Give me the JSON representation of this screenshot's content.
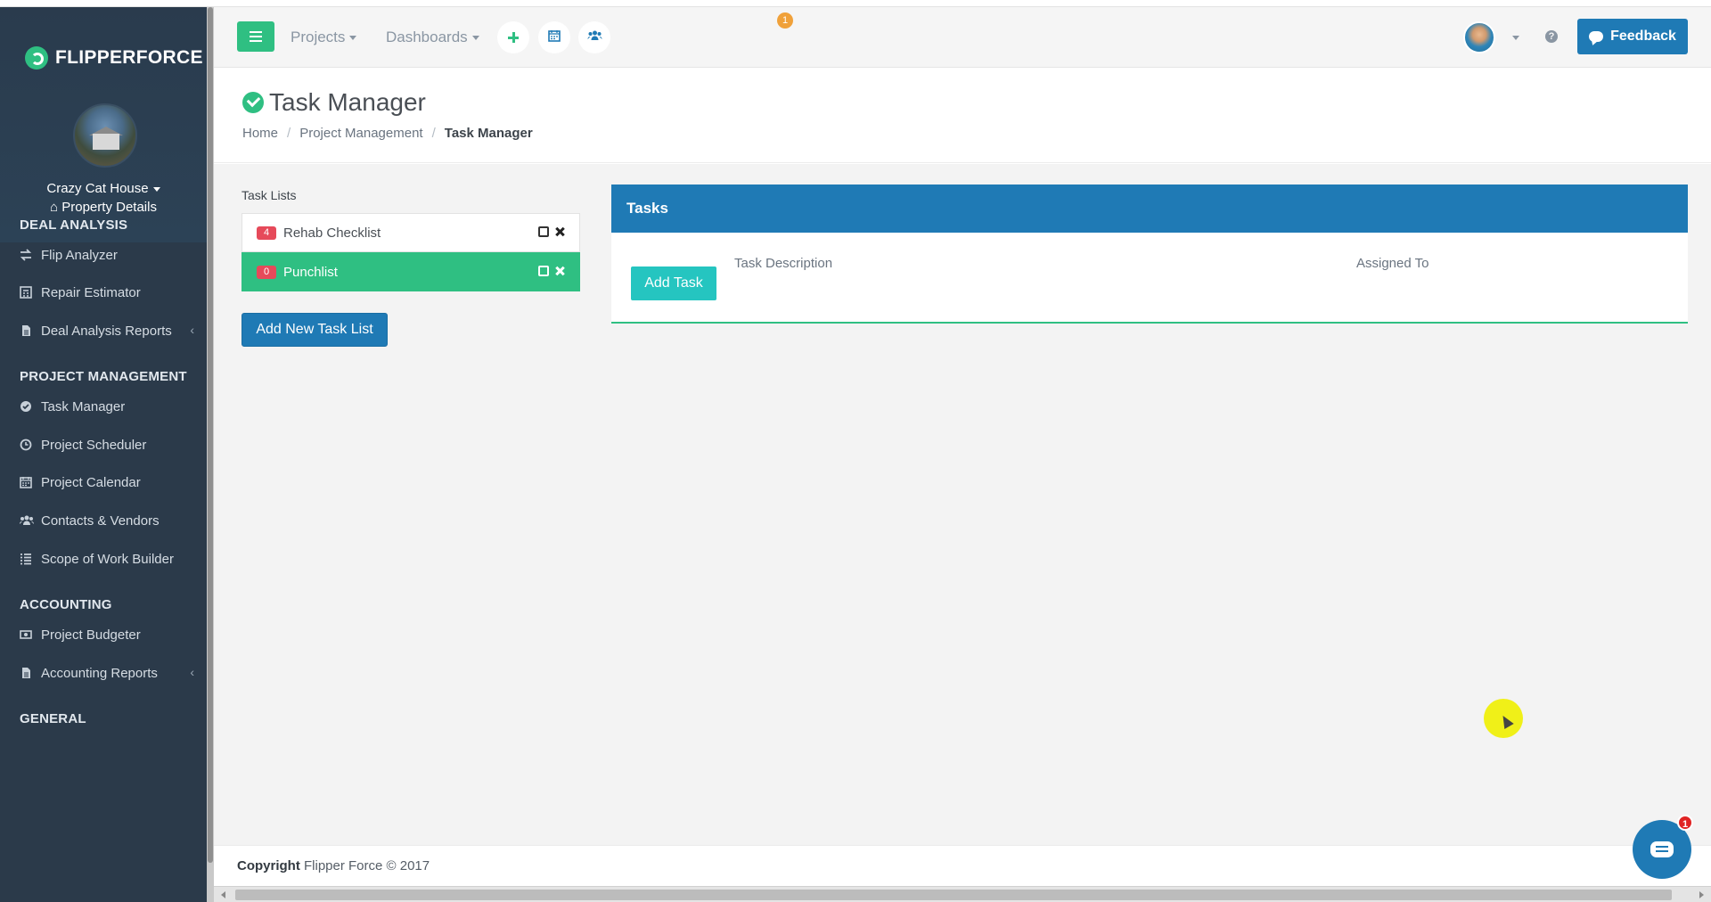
{
  "brand": {
    "name": "FLIPPERFORCE"
  },
  "property": {
    "name": "Crazy Cat House",
    "details_label": "Property Details"
  },
  "sidebar": {
    "sections": [
      {
        "title": "DEAL ANALYSIS",
        "items": [
          {
            "label": "Flip Analyzer",
            "icon": "exchange-icon"
          },
          {
            "label": "Repair Estimator",
            "icon": "calculator-icon"
          },
          {
            "label": "Deal Analysis Reports",
            "icon": "file-icon",
            "expandable": true
          }
        ]
      },
      {
        "title": "PROJECT MANAGEMENT",
        "items": [
          {
            "label": "Task Manager",
            "icon": "check-circle-icon"
          },
          {
            "label": "Project Scheduler",
            "icon": "clock-icon"
          },
          {
            "label": "Project Calendar",
            "icon": "calendar-icon"
          },
          {
            "label": "Contacts & Vendors",
            "icon": "users-icon"
          },
          {
            "label": "Scope of Work Builder",
            "icon": "list-icon"
          }
        ]
      },
      {
        "title": "ACCOUNTING",
        "items": [
          {
            "label": "Project Budgeter",
            "icon": "money-icon"
          },
          {
            "label": "Accounting Reports",
            "icon": "file-icon",
            "expandable": true
          }
        ]
      },
      {
        "title": "GENERAL",
        "items": []
      }
    ]
  },
  "topbar": {
    "projects_label": "Projects",
    "dashboards_label": "Dashboards",
    "calendar_badge": "1",
    "feedback_label": "Feedback"
  },
  "page": {
    "title": "Task Manager",
    "breadcrumb": [
      "Home",
      "Project Management",
      "Task Manager"
    ]
  },
  "task_lists": {
    "label": "Task Lists",
    "items": [
      {
        "name": "Rehab Checklist",
        "count": "4",
        "active": false
      },
      {
        "name": "Punchlist",
        "count": "0",
        "active": true
      }
    ],
    "add_button": "Add New Task List"
  },
  "tasks": {
    "title": "Tasks",
    "add_button": "Add Task",
    "columns": [
      "Task Description",
      "Assigned To"
    ]
  },
  "footer": {
    "copyright_label": "Copyright",
    "copyright_text": "Flipper Force © 2017"
  },
  "chat": {
    "badge": "1"
  },
  "colors": {
    "sidebar": "#2b3a4a",
    "accent_green": "#2fbf82",
    "primary_blue": "#1f7ab5",
    "teal": "#25c5c0",
    "danger": "#e64a5a"
  }
}
